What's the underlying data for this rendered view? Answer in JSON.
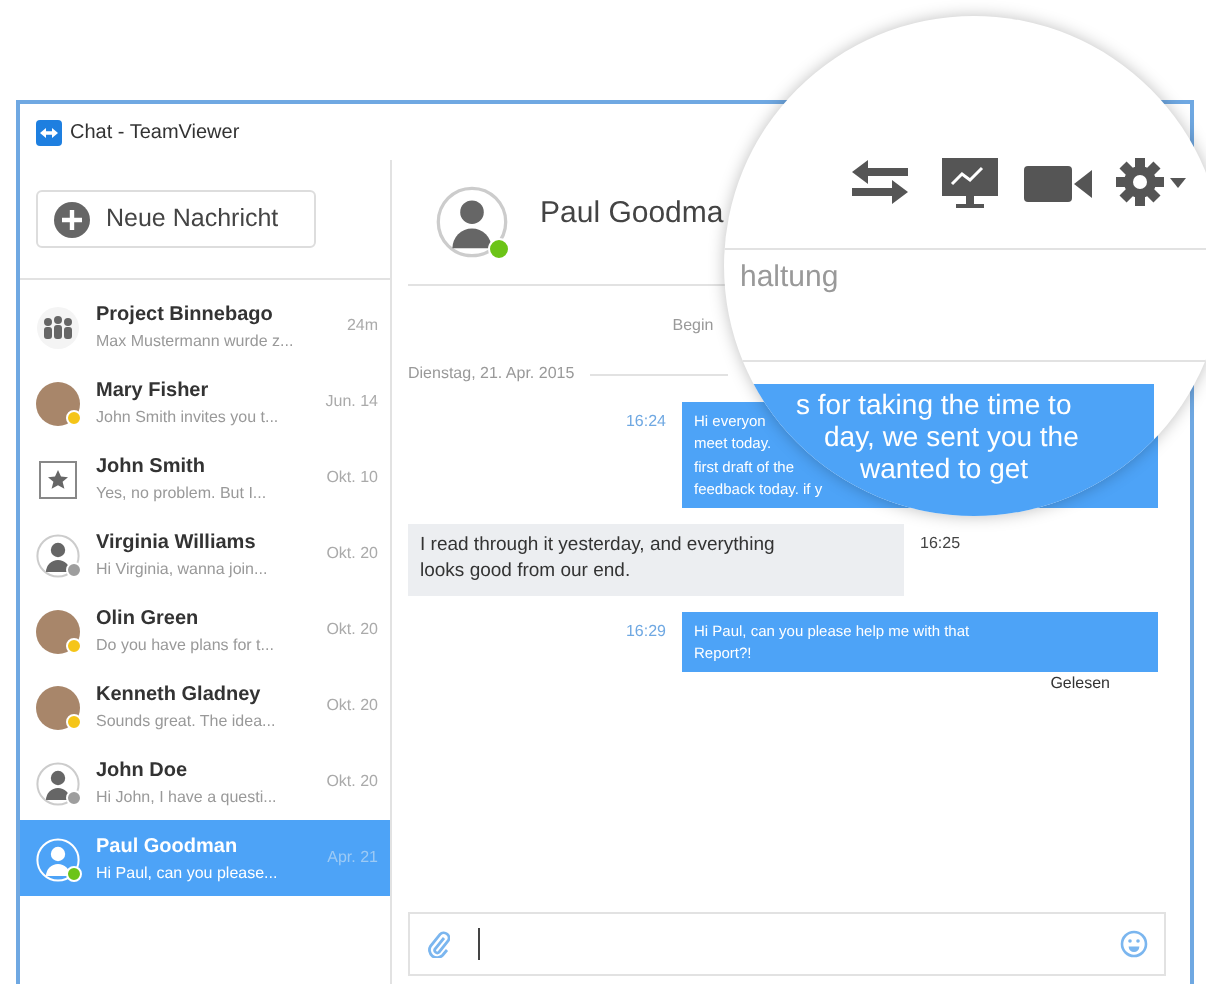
{
  "window": {
    "title": "Chat - TeamViewer"
  },
  "new_message_button": {
    "label": "Neue Nachricht"
  },
  "conversations": [
    {
      "name": "Project Binnebago",
      "preview": "Max Mustermann wurde z...",
      "time": "24m",
      "kind": "group",
      "selected": false
    },
    {
      "name": "Mary Fisher",
      "preview": "John Smith invites you t...",
      "time": "Jun. 14",
      "kind": "photo",
      "color": "#f5c518",
      "selected": false
    },
    {
      "name": "John Smith",
      "preview": "Yes, no problem. But I...",
      "time": "Okt. 10",
      "kind": "star",
      "selected": false
    },
    {
      "name": "Virginia Williams",
      "preview": "Hi Virginia, wanna join...",
      "time": "Okt. 20",
      "kind": "person",
      "color": "#9e9e9e",
      "selected": false
    },
    {
      "name": "Olin Green",
      "preview": "Do you have plans for t...",
      "time": "Okt. 20",
      "kind": "photo",
      "color": "#f5c518",
      "selected": false
    },
    {
      "name": "Kenneth Gladney",
      "preview": "Sounds great. The idea...",
      "time": "Okt. 20",
      "kind": "photo",
      "color": "#f5c518",
      "selected": false
    },
    {
      "name": "John Doe",
      "preview": "Hi John, I have a questi...",
      "time": "Okt. 20",
      "kind": "person",
      "color": "#9e9e9e",
      "selected": false
    },
    {
      "name": "Paul Goodman",
      "preview": "Hi Paul, can you please...",
      "time": "Apr. 21",
      "kind": "person",
      "color": "#6cc417",
      "selected": true
    }
  ],
  "chat": {
    "contact": {
      "name": "Paul Goodma",
      "color": "#6cc417"
    },
    "start_note": "Begin",
    "date": "Dienstag, 21. Apr. 2015",
    "messages": [
      {
        "kind": "outgoing",
        "time": "16:24",
        "lines": [
          "Hi everyon",
          "meet today.",
          "first draft of the",
          "feedback today. if y"
        ]
      },
      {
        "kind": "incoming",
        "time": "16:25",
        "lines": [
          "I read through it yesterday, and everything",
          "looks good from our end."
        ]
      },
      {
        "kind": "outgoing",
        "time": "16:29",
        "lines": [
          "Hi Paul, can you please help me with that",
          "Report?!"
        ],
        "receipt": "Gelesen"
      }
    ]
  },
  "magnifier": {
    "note": "haltung",
    "bubble_lines": [
      "s for taking the time to",
      "day, we sent you the",
      "wanted to get"
    ]
  }
}
